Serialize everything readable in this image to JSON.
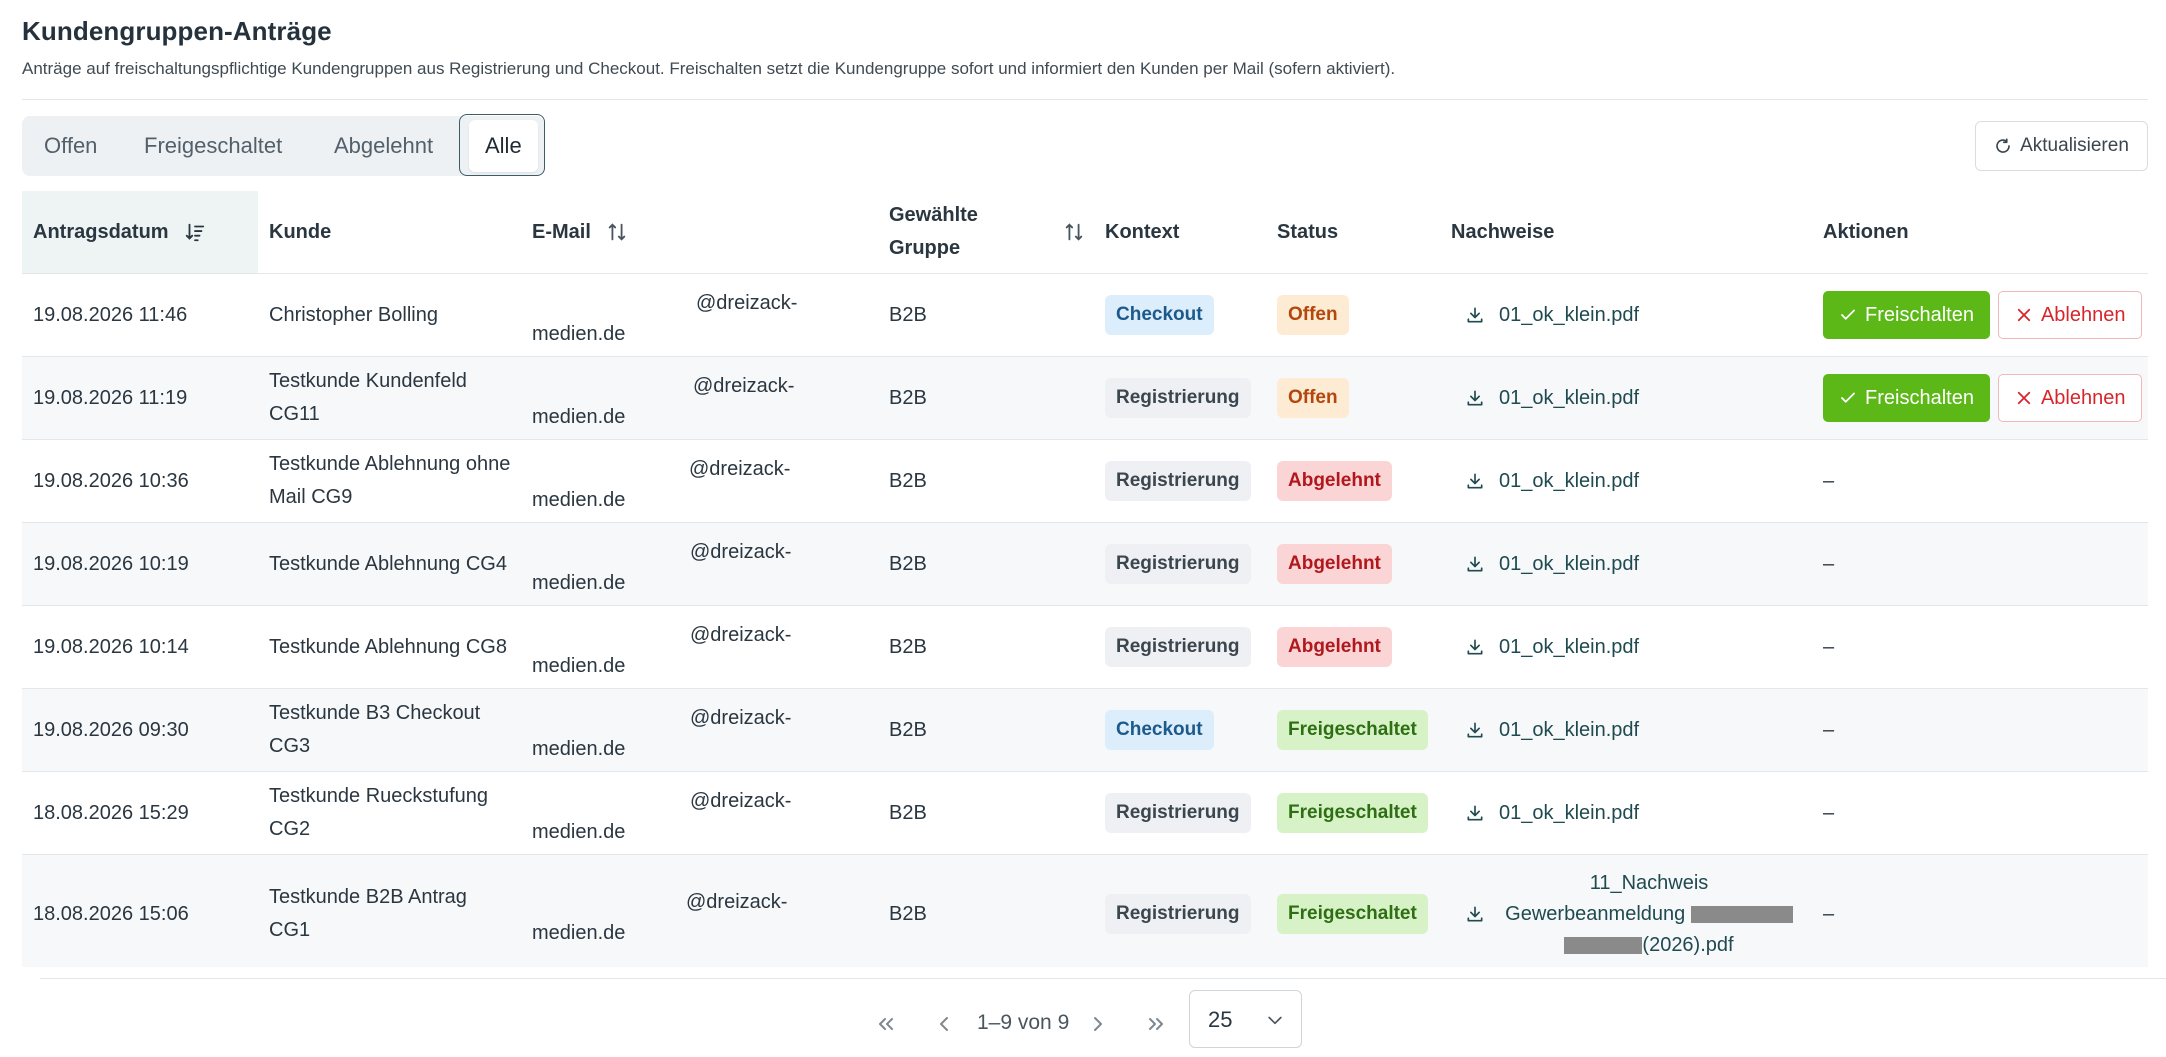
{
  "header": {
    "title": "Kundengruppen-Anträge",
    "description": "Anträge auf freischaltungspflichtige Kundengruppen aus Registrierung und Checkout. Freischalten setzt die Kundengruppe sofort und informiert den Kunden per Mail (sofern aktiviert)."
  },
  "tabs": [
    {
      "label": "Offen"
    },
    {
      "label": "Freigeschaltet"
    },
    {
      "label": "Abgelehnt"
    },
    {
      "label": "Alle",
      "active": true
    }
  ],
  "refresh_label": "Aktualisieren",
  "table": {
    "columns": {
      "date": "Antragsdatum",
      "customer": "Kunde",
      "email": "E-Mail",
      "group": "Gewählte Gruppe",
      "context": "Kontext",
      "status": "Status",
      "proof": "Nachweise",
      "actions": "Aktionen"
    },
    "rows": [
      {
        "date": "19.08.2026 11:46",
        "customer": "Christopher Bolling",
        "email_local": "@dreizack-",
        "email_domain": "medien.de",
        "group": "B2B",
        "context": "Checkout",
        "status": "Offen",
        "file": "01_ok_klein.pdf",
        "actions": true
      },
      {
        "date": "19.08.2026 11:19",
        "customer": "Testkunde Kundenfeld CG11",
        "email_local": "@dreizack-",
        "email_domain": "medien.de",
        "group": "B2B",
        "context": "Registrierung",
        "status": "Offen",
        "file": "01_ok_klein.pdf",
        "actions": true
      },
      {
        "date": "19.08.2026 10:36",
        "customer": "Testkunde Ablehnung ohne Mail CG9",
        "email_local": "@dreizack-",
        "email_domain": "medien.de",
        "group": "B2B",
        "context": "Registrierung",
        "status": "Abgelehnt",
        "file": "01_ok_klein.pdf",
        "actions": false
      },
      {
        "date": "19.08.2026 10:19",
        "customer": "Testkunde Ablehnung CG4",
        "email_local": "@dreizack-",
        "email_domain": "medien.de",
        "group": "B2B",
        "context": "Registrierung",
        "status": "Abgelehnt",
        "file": "01_ok_klein.pdf",
        "actions": false
      },
      {
        "date": "19.08.2026 10:14",
        "customer": "Testkunde Ablehnung CG8",
        "email_local": "@dreizack-",
        "email_domain": "medien.de",
        "group": "B2B",
        "context": "Registrierung",
        "status": "Abgelehnt",
        "file": "01_ok_klein.pdf",
        "actions": false
      },
      {
        "date": "19.08.2026 09:30",
        "customer": "Testkunde B3 Checkout CG3",
        "email_local": "@dreizack-",
        "email_domain": "medien.de",
        "group": "B2B",
        "context": "Checkout",
        "status": "Freigeschaltet",
        "file": "01_ok_klein.pdf",
        "actions": false
      },
      {
        "date": "18.08.2026 15:29",
        "customer": "Testkunde Rueckstufung CG2",
        "email_local": "@dreizack-",
        "email_domain": "medien.de",
        "group": "B2B",
        "context": "Registrierung",
        "status": "Freigeschaltet",
        "file": "01_ok_klein.pdf",
        "actions": false
      },
      {
        "date": "18.08.2026 15:06",
        "customer": "Testkunde B2B Antrag CG1",
        "email_local": "@dreizack-",
        "email_domain": "medien.de",
        "group": "B2B",
        "context": "Registrierung",
        "status": "Freigeschaltet",
        "file_lines": [
          "11_Nachweis",
          "Gewerbeanmeldung",
          "(2026).pdf"
        ],
        "actions": false
      }
    ],
    "approve_label": "Freischalten",
    "reject_label": "Ablehnen",
    "no_action": "–"
  },
  "pagination": {
    "range_text": "1–9 von 9",
    "page_size": "25"
  }
}
